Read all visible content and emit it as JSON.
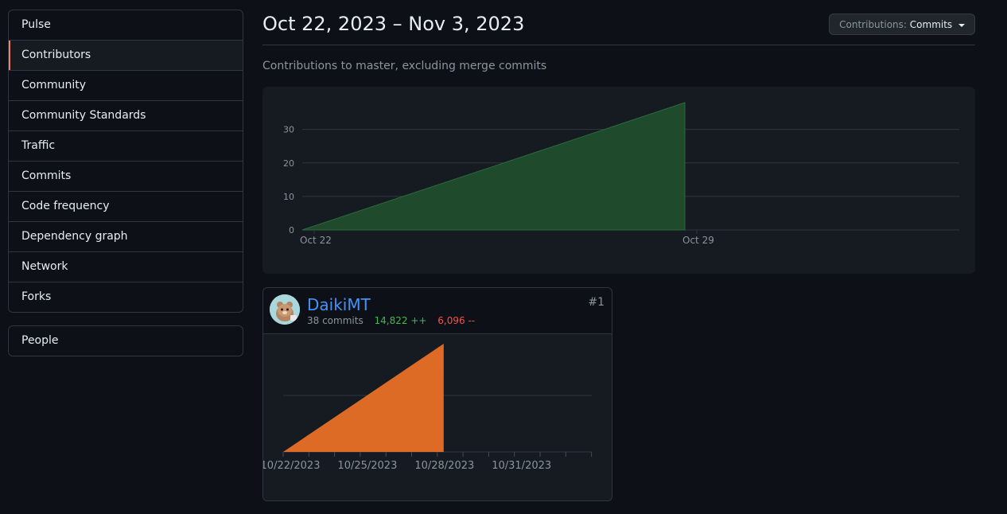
{
  "sidebar": {
    "items": [
      {
        "label": "Pulse"
      },
      {
        "label": "Contributors"
      },
      {
        "label": "Community"
      },
      {
        "label": "Community Standards"
      },
      {
        "label": "Traffic"
      },
      {
        "label": "Commits"
      },
      {
        "label": "Code frequency"
      },
      {
        "label": "Dependency graph"
      },
      {
        "label": "Network"
      },
      {
        "label": "Forks"
      }
    ],
    "selected_index": 1,
    "people_label": "People"
  },
  "header": {
    "title": "Oct 22, 2023 – Nov 3, 2023",
    "contrib_label": "Contributions:",
    "contrib_value": "Commits"
  },
  "subtitle": "Contributions to master, excluding merge commits",
  "contributor": {
    "name": "DaikiMT",
    "commits": "38 commits",
    "additions": "14,822 ++",
    "deletions": "6,096 --",
    "rank": "#1"
  },
  "colors": {
    "main_area": "#1f4a2b",
    "main_area_stroke": "#2d6a3b",
    "card_area": "#dd6b26",
    "grid": "#30363d",
    "axis_text": "#8b949e"
  },
  "chart_data": [
    {
      "type": "area",
      "x": [
        "Oct 22",
        "Oct 29"
      ],
      "y": [
        0,
        38
      ],
      "xticks": [
        "Oct 22",
        "Oct 29"
      ],
      "yticks": [
        0,
        10,
        20,
        30
      ],
      "ylim": [
        0,
        38
      ]
    },
    {
      "type": "area",
      "x": [
        "10/22/2023",
        "10/28/2023"
      ],
      "y": [
        0,
        38
      ],
      "xticks": [
        "10/22/2023",
        "10/25/2023",
        "10/28/2023",
        "10/31/2023"
      ],
      "ylim": [
        0,
        38
      ]
    }
  ]
}
